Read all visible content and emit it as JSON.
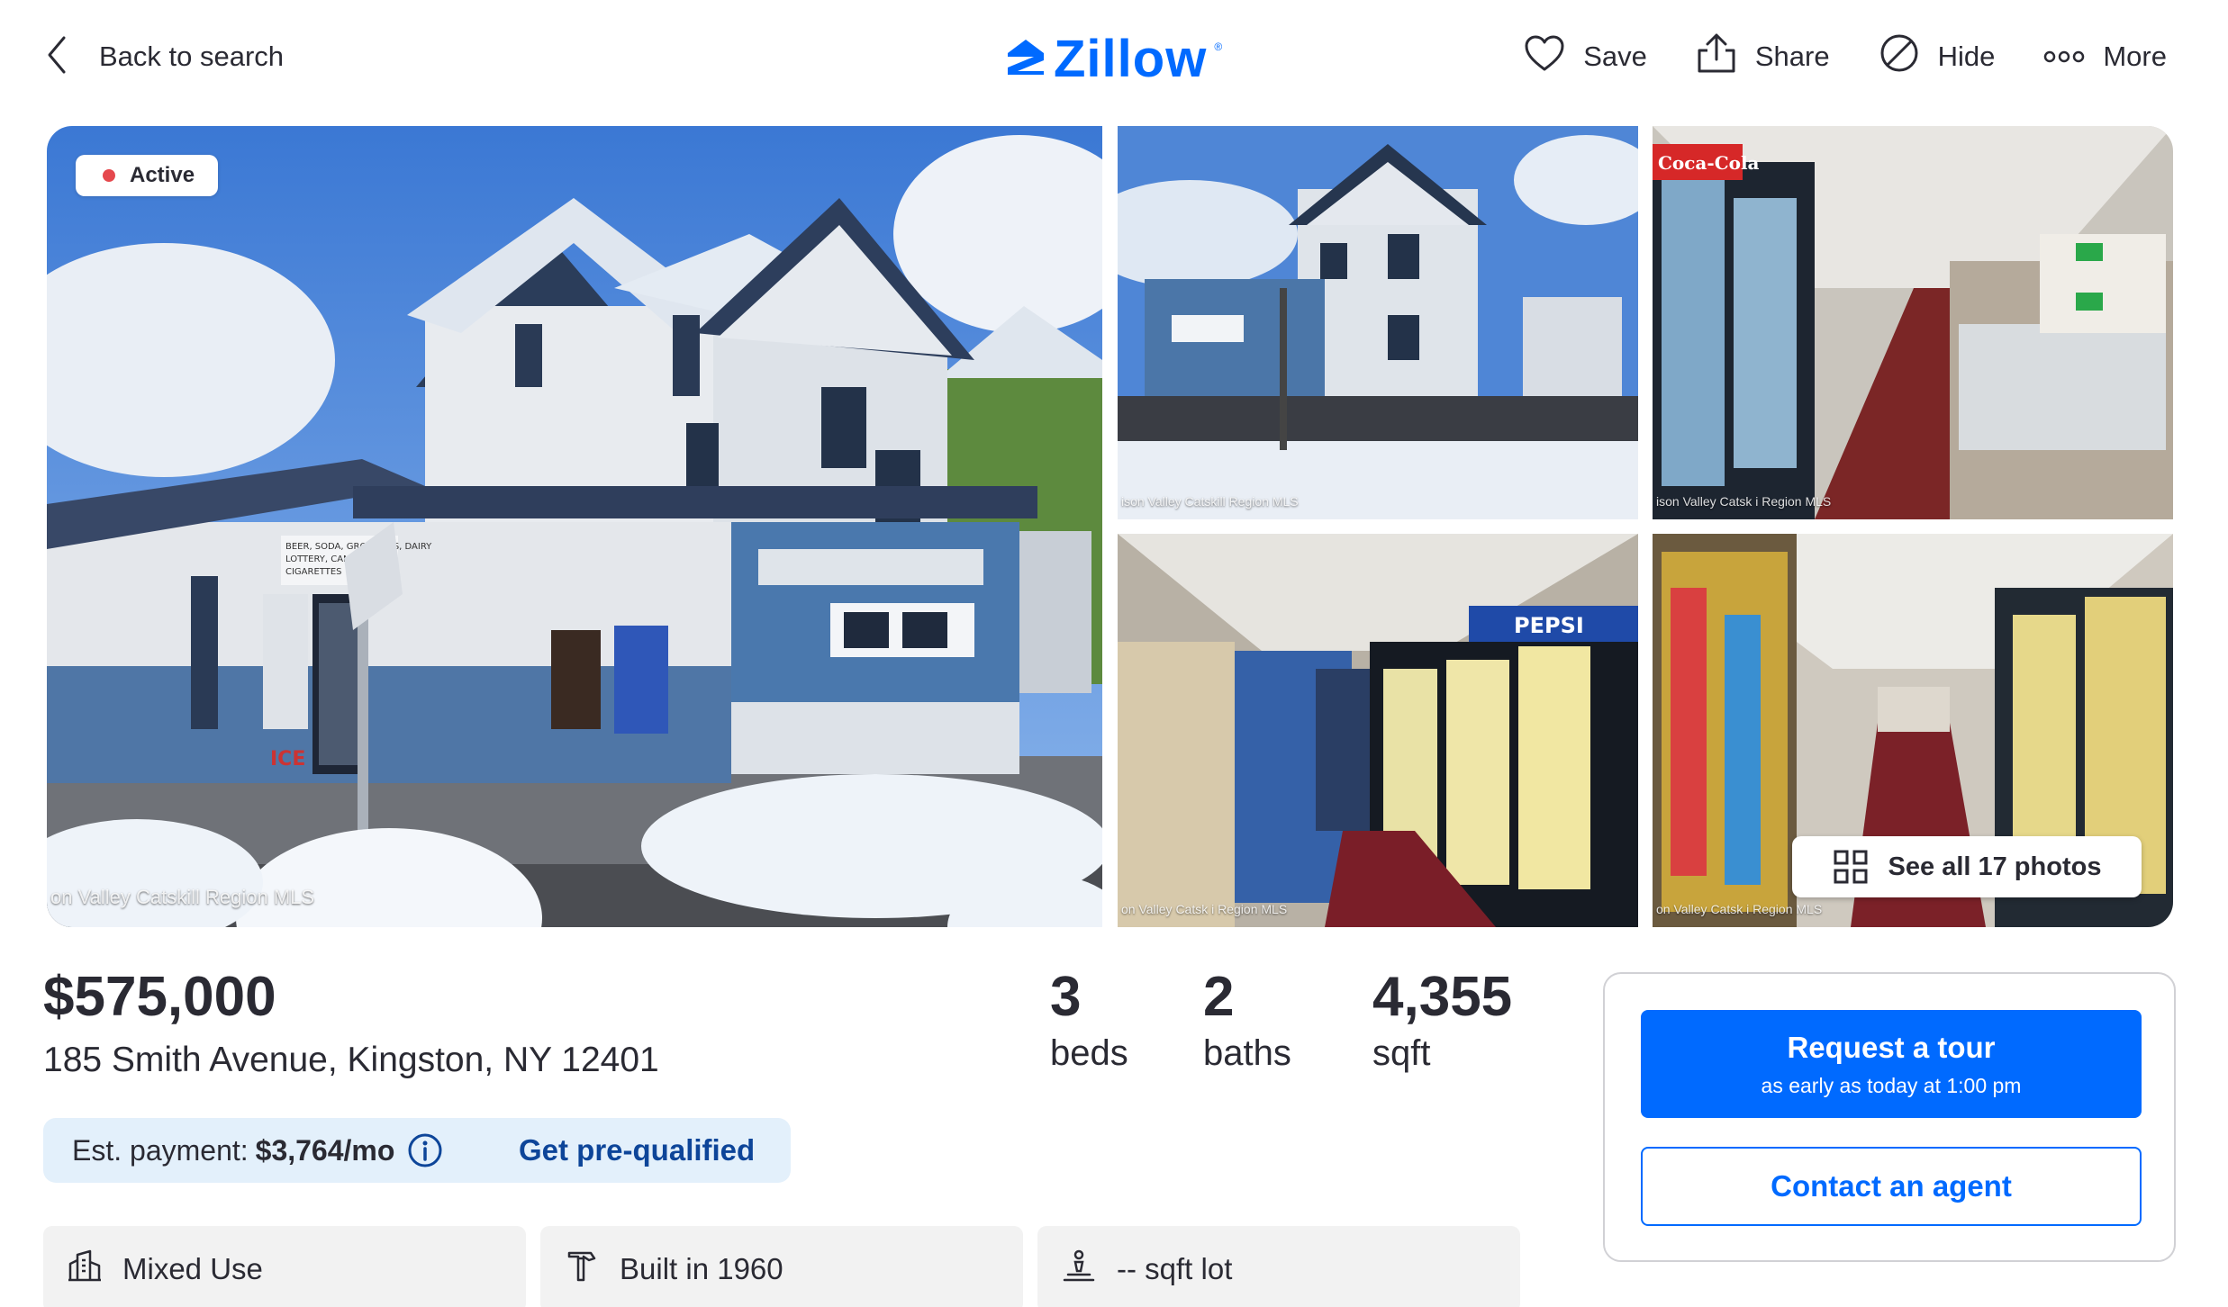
{
  "header": {
    "back_label": "Back to search",
    "logo_text": "Zillow",
    "logo_mark": "®",
    "actions": {
      "save": "Save",
      "share": "Share",
      "hide": "Hide",
      "more": "More"
    }
  },
  "gallery": {
    "status_badge": "Active",
    "main_watermark": "on Valley Catskill Region MLS",
    "thumb1_watermark": "ison Valley Catskill Region MLS",
    "thumb2_watermark": "ison Valley Catsk i Region MLS",
    "thumb3_watermark": "on Valley Catsk i Region MLS",
    "thumb4_watermark": "on Valley Catsk i Region MLS",
    "see_all_label": "See all 17 photos",
    "store_signs": {
      "ice": "ICE",
      "store_sign": "BEER, SODA, GROCERIES, DAIRY, LOTTERY, CANDY, CIGARETTES",
      "pepsi": "PEPSI",
      "coca_cola": "Coca-Cola"
    }
  },
  "listing": {
    "price": "$575,000",
    "address": "185 Smith Avenue, Kingston, NY 12401",
    "beds_value": "3",
    "beds_label": "beds",
    "baths_value": "2",
    "baths_label": "baths",
    "sqft_value": "4,355",
    "sqft_label": "sqft"
  },
  "payment": {
    "label": "Est. payment:",
    "amount": "$3,764/mo",
    "prequalify_label": "Get pre-qualified"
  },
  "facts": [
    {
      "label": "Mixed Use",
      "icon": "building-chart-icon"
    },
    {
      "label": "Built in 1960",
      "icon": "hammer-icon"
    },
    {
      "label": "-- sqft lot",
      "icon": "lot-icon"
    }
  ],
  "tour_card": {
    "request_tour_label": "Request a tour",
    "request_tour_sub": "as early as today at 1:00 pm",
    "contact_agent_label": "Contact an agent"
  },
  "colors": {
    "brand_blue": "#006aff",
    "prequal_text": "#0d4599",
    "payment_bg": "#e3f0fb",
    "status_dot": "#e5484d"
  }
}
